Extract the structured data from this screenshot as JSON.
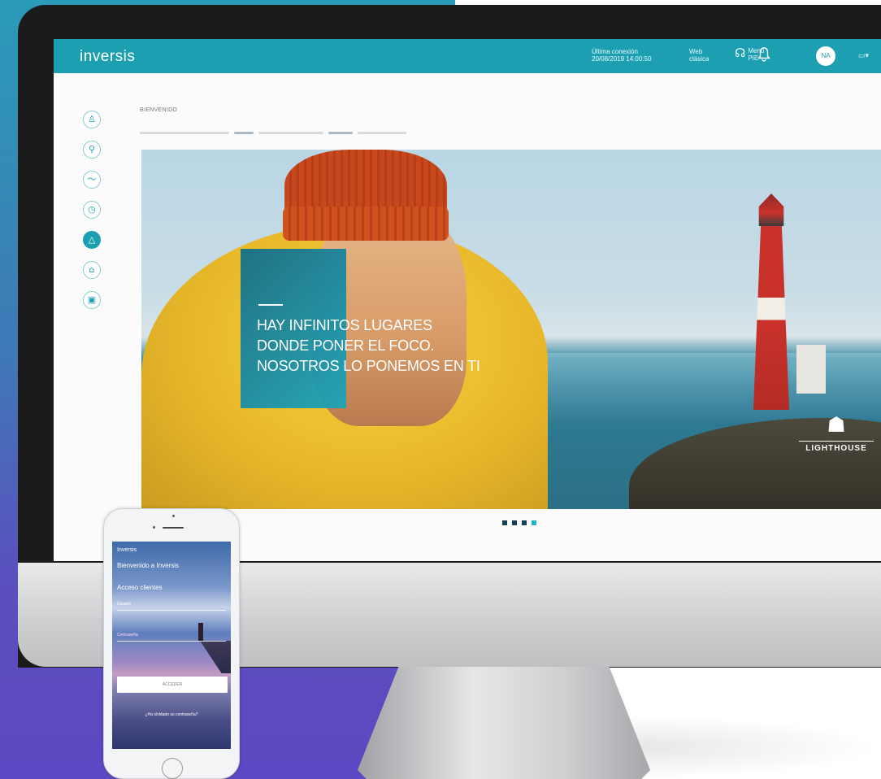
{
  "app": {
    "logo": "inversis",
    "last_connection": [
      "Última conexión",
      "20/08/2019 14:00:50"
    ],
    "web_clasica": [
      "Web",
      "clásica"
    ],
    "menu_pie_glyph": "☊",
    "menu_pie": [
      "Menú",
      "PIE"
    ],
    "bell_icon": "🔔",
    "avatar_initials": "NA",
    "lang": "▭▾"
  },
  "sidebar": {
    "items": [
      {
        "icon": "person-icon",
        "glyph": "♙"
      },
      {
        "icon": "portfolio-icon",
        "glyph": "⚲"
      },
      {
        "icon": "chart-icon",
        "glyph": "〜"
      },
      {
        "icon": "clock-icon",
        "glyph": "◷"
      },
      {
        "icon": "alert-icon",
        "glyph": "△",
        "active": true
      },
      {
        "icon": "building-icon",
        "glyph": "⌂"
      },
      {
        "icon": "monitor-icon",
        "glyph": "▣"
      }
    ]
  },
  "main": {
    "greeting": "BIENVENIDO",
    "hero": {
      "headline": [
        "HAY INFINITOS LUGARES",
        "DONDE PONER EL FOCO.",
        "NOSOTROS LO PONEMOS EN TI"
      ],
      "brand_icon": "☗",
      "brand": "LIGHTHOUSE"
    },
    "carousel": {
      "count": 4,
      "active_index": 3
    }
  },
  "phone": {
    "top_label": "Inversis",
    "welcome": "Bienvenido a Inversis",
    "access": "Acceso clientes",
    "user_label": "Usuario",
    "password_label": "Contraseña",
    "login_button": "ACCEDER",
    "forgot": "¿Ha olvidado su contraseña?"
  },
  "colors": {
    "brand_teal": "#1d9fb2",
    "dark_navy": "#173f55",
    "active_dot": "#1db3c6"
  }
}
